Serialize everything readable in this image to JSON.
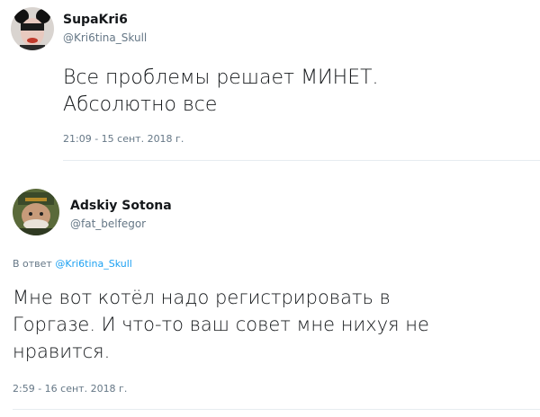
{
  "tweets": [
    {
      "display_name": "SupaKri6",
      "handle": "@Kri6tina_Skull",
      "text_line1": "Все проблемы решает МИНЕТ.",
      "text_line2": "Абсолютно все",
      "timestamp": "21:09 - 15 сент. 2018 г."
    },
    {
      "display_name": "Adskiy Sotona",
      "handle": "@fat_belfegor",
      "reply_prefix": "В ответ",
      "reply_to": "@Kri6tina_Skull",
      "text_line1": "Мне вот котёл надо регистрировать в",
      "text_line2": "Горгазе. И что-то ваш совет мне нихуя не",
      "text_line3": "нравится.",
      "timestamp": "2:59 - 16 сент. 2018 г."
    }
  ],
  "colors": {
    "text": "#14171a",
    "secondary": "#657786",
    "link": "#1da1f2",
    "divider": "#e6ecf0"
  }
}
